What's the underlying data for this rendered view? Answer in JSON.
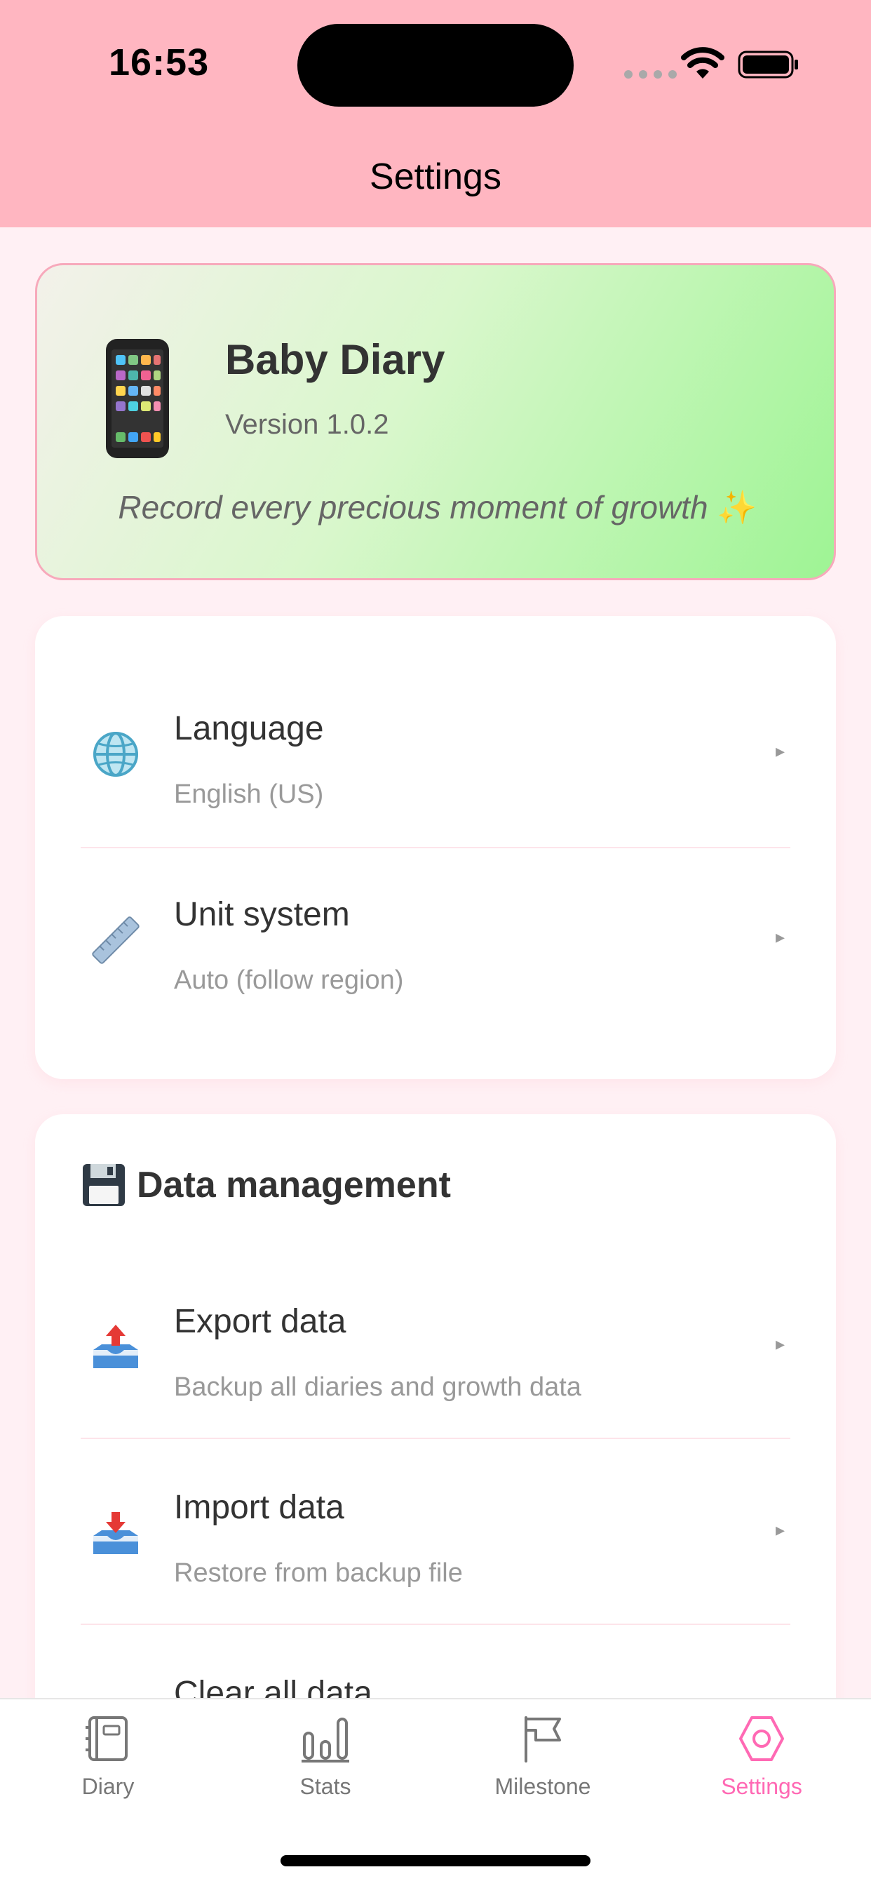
{
  "status": {
    "time": "16:53"
  },
  "header": {
    "title": "Settings"
  },
  "hero": {
    "title": "Baby Diary",
    "version": "Version 1.0.2",
    "tagline": "Record every precious moment of growth",
    "tagline_emoji": "✨",
    "icon": "phone-icon"
  },
  "preferences": {
    "items": [
      {
        "title": "Language",
        "subtitle": "English (US)",
        "icon": "globe-icon"
      },
      {
        "title": "Unit system",
        "subtitle": "Auto (follow region)",
        "icon": "ruler-icon"
      }
    ]
  },
  "data_management": {
    "title": "Data management",
    "icon": "floppy-disk-icon",
    "items": [
      {
        "title": "Export data",
        "subtitle": "Backup all diaries and growth data",
        "icon": "outbox-tray-icon"
      },
      {
        "title": "Import data",
        "subtitle": "Restore from backup file",
        "icon": "inbox-tray-icon"
      },
      {
        "title": "Clear all data",
        "icon": "trash-icon"
      }
    ]
  },
  "chevron": "▸",
  "tabs": [
    {
      "label": "Diary",
      "icon": "diary-icon"
    },
    {
      "label": "Stats",
      "icon": "bar-chart-icon"
    },
    {
      "label": "Milestone",
      "icon": "flag-icon"
    },
    {
      "label": "Settings",
      "icon": "gear-icon",
      "active": true
    }
  ],
  "colors": {
    "header": "#ffb6c1",
    "accent": "#ff69b4",
    "background": "#fff0f4"
  }
}
